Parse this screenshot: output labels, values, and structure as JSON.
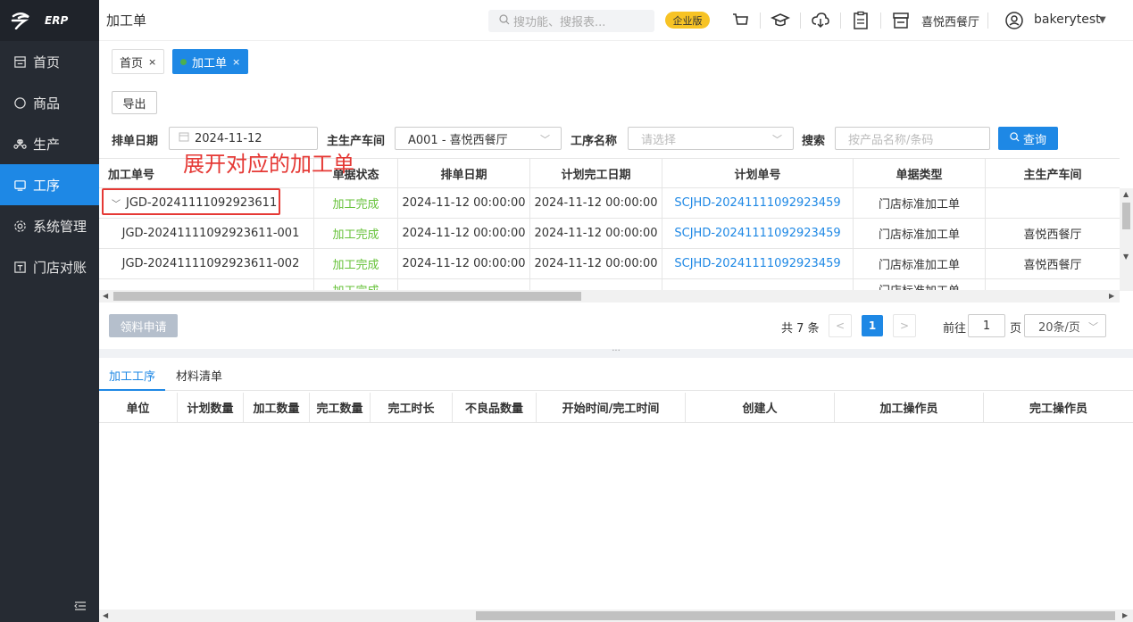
{
  "app": {
    "logo_text": "ERP",
    "header_title": "加工单"
  },
  "sidebar": {
    "items": [
      {
        "label": "首页",
        "icon": "home-icon"
      },
      {
        "label": "商品",
        "icon": "circle-icon"
      },
      {
        "label": "生产",
        "icon": "command-icon"
      },
      {
        "label": "工序",
        "icon": "monitor-icon",
        "active": true
      },
      {
        "label": "系统管理",
        "icon": "gear-icon"
      },
      {
        "label": "门店对账",
        "icon": "ledger-icon"
      }
    ]
  },
  "header": {
    "search_placeholder": "搜功能、搜报表...",
    "edition_badge": "企业版",
    "store_name": "喜悦西餐厅",
    "user_name": "bakerytest",
    "badge_color": "#f7c325"
  },
  "tabs": [
    {
      "label": "首页",
      "close": "×"
    },
    {
      "label": "加工单",
      "close": "×",
      "active": true
    }
  ],
  "toolbar": {
    "export_label": "导出"
  },
  "filters": {
    "date_label": "排单日期",
    "date_value": "2024-11-12",
    "workshop_label": "主生产车间",
    "workshop_value": "A001 - 喜悦西餐厅",
    "process_label": "工序名称",
    "process_placeholder": "请选择",
    "search_label": "搜索",
    "search_placeholder": "按产品名称/条码",
    "query_label": "查询"
  },
  "annotation": "展开对应的加工单",
  "table": {
    "headers": [
      "加工单号",
      "单据状态",
      "排单日期",
      "计划完工日期",
      "计划单号",
      "单据类型",
      "主生产车间"
    ],
    "rows": [
      [
        "JGD-20241111092923611",
        "加工完成",
        "2024-11-12 00:00:00",
        "2024-11-12 00:00:00",
        "SCJHD-20241111092923459",
        "门店标准加工单",
        ""
      ],
      [
        "JGD-20241111092923611-001",
        "加工完成",
        "2024-11-12 00:00:00",
        "2024-11-12 00:00:00",
        "SCJHD-20241111092923459",
        "门店标准加工单",
        "喜悦西餐厅"
      ],
      [
        "JGD-20241111092923611-002",
        "加工完成",
        "2024-11-12 00:00:00",
        "2024-11-12 00:00:00",
        "SCJHD-20241111092923459",
        "门店标准加工单",
        "喜悦西餐厅"
      ]
    ]
  },
  "actions": {
    "material_request": "领料申请"
  },
  "pagination": {
    "total": "共 7 条",
    "current_page": "1",
    "goto_label": "前往",
    "goto_value": "1",
    "page_suffix": "页",
    "page_size": "20条/页"
  },
  "bottom_tabs": [
    "加工工序",
    "材料清单"
  ],
  "detail_table": {
    "headers": [
      "单位",
      "计划数量",
      "加工数量",
      "完工数量",
      "完工时长",
      "不良品数量",
      "开始时间/完工时间",
      "创建人",
      "加工操作员",
      "完工操作员"
    ]
  }
}
